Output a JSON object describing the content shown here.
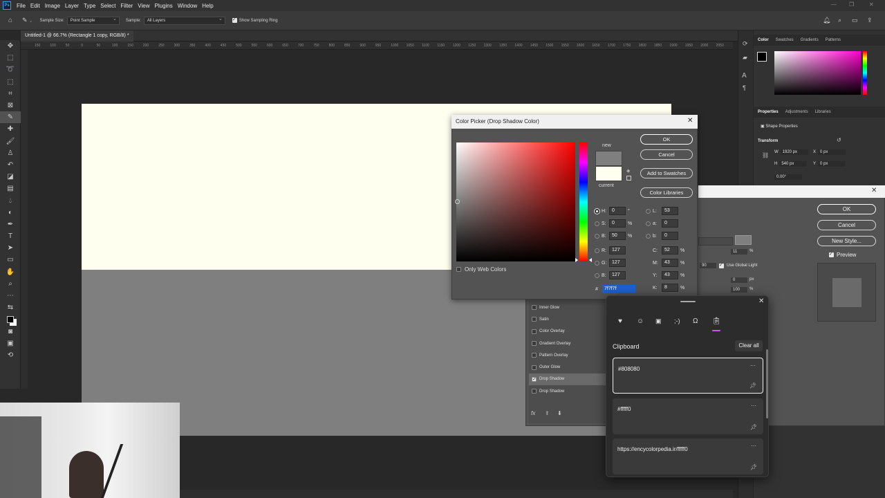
{
  "app": {
    "icon_label": "Ps"
  },
  "menu": [
    "File",
    "Edit",
    "Image",
    "Layer",
    "Type",
    "Select",
    "Filter",
    "View",
    "Plugins",
    "Window",
    "Help"
  ],
  "options": {
    "sample_size_label": "Sample Size:",
    "sample_size_value": "Point Sample",
    "sample_label": "Sample:",
    "sample_value": "All Layers",
    "show_ring_label": "Show Sampling Ring"
  },
  "document": {
    "tab_title": "Untitled-1 @ 66.7% (Rectangle 1 copy, RGB/8) *"
  },
  "ruler_labels": [
    "150",
    "100",
    "50",
    "0",
    "50",
    "100",
    "150",
    "200",
    "250",
    "300",
    "350",
    "400",
    "450",
    "500",
    "550",
    "600",
    "650",
    "700",
    "750",
    "800",
    "850",
    "900",
    "950",
    "1000",
    "1050",
    "1100",
    "1150",
    "1200",
    "1250",
    "1300",
    "1350",
    "1400",
    "1450",
    "1500",
    "1550",
    "1600",
    "1650",
    "1700",
    "1750",
    "1800",
    "1850",
    "1900",
    "1950",
    "2000",
    "2050"
  ],
  "right_panel": {
    "color_tabs": [
      "Color",
      "Swatches",
      "Gradients",
      "Patterns"
    ],
    "props_tabs": [
      "Properties",
      "Adjustments",
      "Libraries"
    ],
    "shape_props_label": "Shape Properties",
    "transform_label": "Transform",
    "w_label": "W",
    "w_value": "1920 px",
    "h_label": "H",
    "h_value": "540 px",
    "x_label": "X",
    "x_value": "0 px",
    "y_label": "Y",
    "y_value": "0 px",
    "angle_value": "0.00°"
  },
  "layer_style": {
    "ok": "OK",
    "cancel": "Cancel",
    "new_style": "New Style...",
    "preview": "Preview",
    "opacity_value": "11",
    "pct": "%",
    "angle_value": "90",
    "use_global_light": "Use Global Light",
    "distance_value": "0",
    "size_value": "100",
    "px": "px",
    "styles": [
      "Inner Glow",
      "Satin",
      "Color Overlay",
      "Gradient Overlay",
      "Pattern Overlay",
      "Outer Glow",
      "Drop Shadow",
      "Drop Shadow"
    ],
    "fx_label": "fx"
  },
  "color_picker": {
    "title": "Color Picker (Drop Shadow Color)",
    "ok": "OK",
    "cancel": "Cancel",
    "add_to_swatches": "Add to Swatches",
    "color_libraries": "Color Libraries",
    "new_label": "new",
    "current_label": "current",
    "new_color": "#7f7f7f",
    "current_color": "#fffff0",
    "only_web_colors": "Only Web Colors",
    "fields": {
      "H": "0",
      "S": "0",
      "Bh": "50",
      "R": "127",
      "G": "127",
      "B": "127",
      "L": "53",
      "a": "0",
      "b": "0",
      "C": "52",
      "M": "43",
      "Y": "43",
      "K": "8"
    },
    "units": {
      "deg": "°",
      "pct": "%"
    },
    "hex_label": "#",
    "hex_value": "7f7f7f"
  },
  "clipboard": {
    "title": "Clipboard",
    "clear_all": "Clear all",
    "items": [
      "#808080",
      "#fffff0",
      "https://encycolorpedia.ir/fffff0"
    ]
  }
}
